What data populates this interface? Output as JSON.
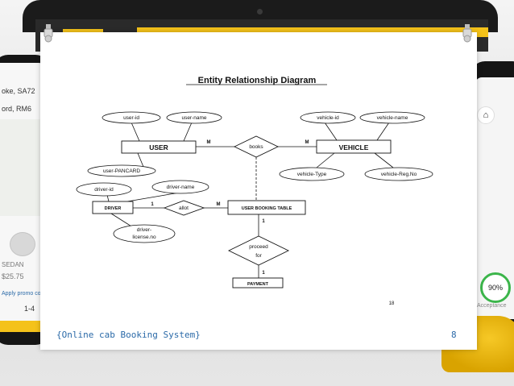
{
  "background": {
    "left_phone": {
      "lines": [
        "oke, SA72",
        "ord, RM6",
        "SEDAN",
        "$25.75",
        "Apply promo code",
        "1-4"
      ]
    },
    "right_phone": {
      "gauge_value": "90%",
      "caption": "Acceptance"
    }
  },
  "slide": {
    "footer_left": "{Online cab Booking System}",
    "page_number": "8"
  },
  "diagram": {
    "title": "Entity Relationship Diagram",
    "entities": {
      "user": "USER",
      "vehicle": "VEHICLE",
      "driver": "DRIVER",
      "user_booking_table": "USER BOOKING TABLE",
      "payment": "PAYMENT"
    },
    "attributes": {
      "user_id": "user-id",
      "user_name": "user-name",
      "user_pancard": "user-PANCARD",
      "vehicle_id": "vehicle-id",
      "vehicle_name": "vehicle-name",
      "vehicle_type": "vehicle-Type",
      "vehicle_reg_no": "vehicle-Reg.No",
      "driver_id": "driver-id",
      "driver_name": "driver-name",
      "driver_license_line1": "driver-",
      "driver_license_line2": "license.no"
    },
    "relationships": {
      "books": "books",
      "allot": "allot",
      "proceed_line1": "proceed",
      "proceed_line2": "for"
    },
    "cardinalities": {
      "books_user": "M",
      "books_vehicle": "M",
      "allot_driver": "1",
      "allot_booking": "M",
      "booking_proceed": "1",
      "proceed_payment": "1"
    },
    "page_label": "18"
  },
  "colors": {
    "footer_text": "#2b6aa8",
    "accent_yellow": "#f4c21a",
    "diagram_ink": "#111111"
  }
}
